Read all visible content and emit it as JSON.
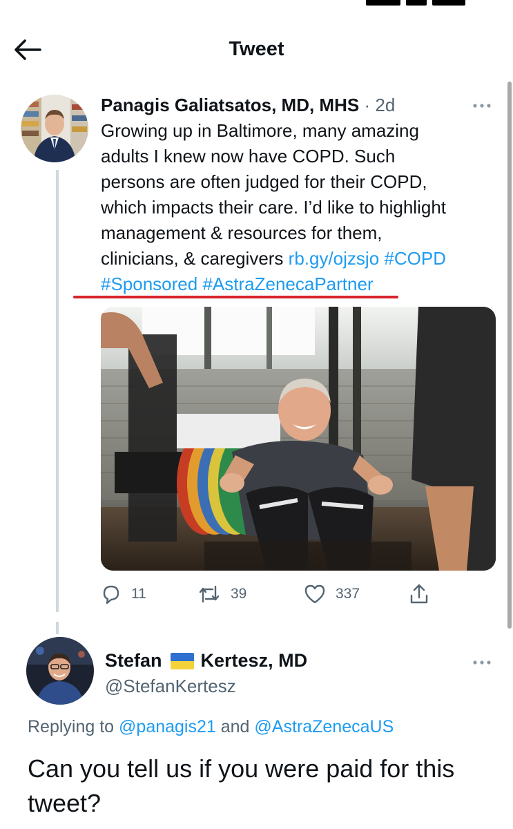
{
  "header": {
    "title": "Tweet",
    "back_icon": "arrow-left-icon"
  },
  "tweet": {
    "author_name": "Panagis Galiatsatos, MD, MHS",
    "separator": "·",
    "time": "2d",
    "text_lines": [
      "Growing up in Baltimore, many amazing",
      "adults I knew now have COPD. Such",
      "persons are often judged for their COPD,",
      "which impacts their care. I’d like to highlight",
      "management & resources for them,"
    ],
    "text_line6_plain": "clinicians, & caregivers ",
    "link_url": "rb.gy/ojzsjo",
    "hashtag_copd": "#COPD",
    "hashtag_sponsored": "#Sponsored",
    "hashtag_partner": "#AstraZenecaPartner",
    "annotation_color": "#d8232a",
    "media_icon": "photo-man-exercising",
    "stats": {
      "replies": "11",
      "retweets": "39",
      "likes": "337"
    }
  },
  "reply": {
    "name_first": "Stefan",
    "flag_icon": "ukraine-flag-icon",
    "name_last": "Kertesz, MD",
    "handle": "@StefanKertesz",
    "replying_prefix": "Replying to ",
    "replying_user1": "@panagis21",
    "replying_and": " and ",
    "replying_user2": "@AstraZenecaUS",
    "text": "Can you tell us if you were paid for this tweet?"
  },
  "colors": {
    "link": "#1d9bf0",
    "secondary_text": "#536471",
    "primary_text": "#0f1419"
  }
}
